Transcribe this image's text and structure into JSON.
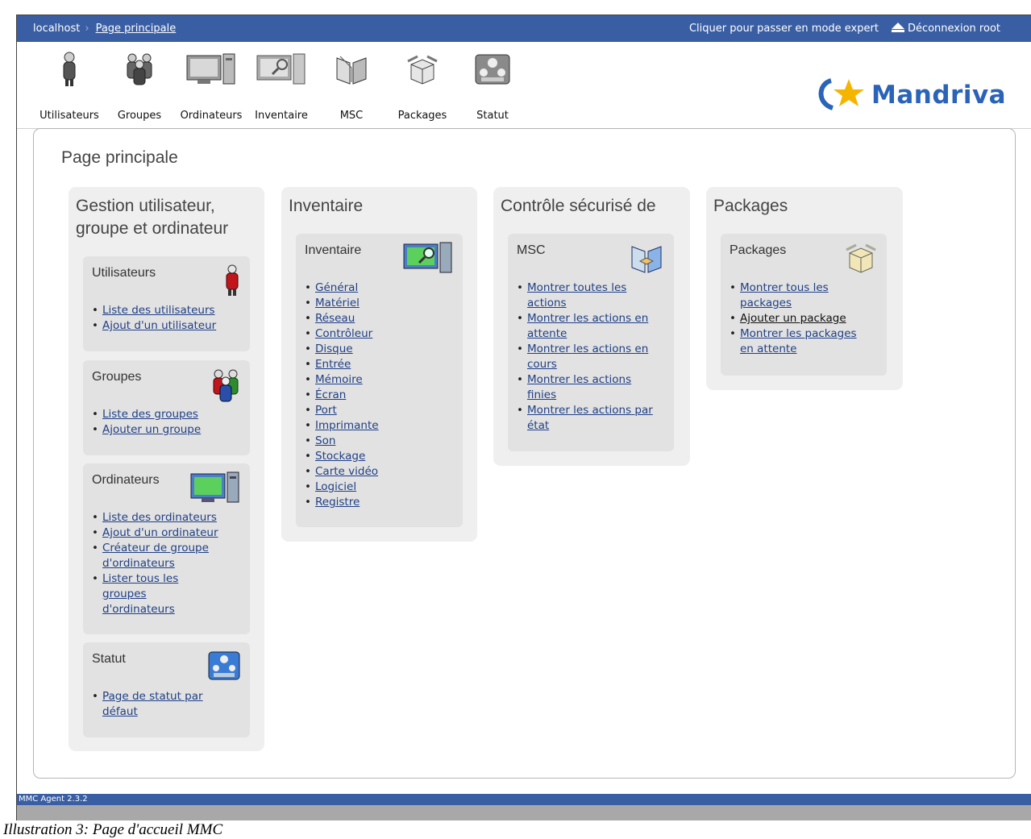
{
  "topbar": {
    "host": "localhost",
    "breadcrumb": "Page principale",
    "expert_link": "Cliquer pour passer en mode expert",
    "logout": "Déconnexion root"
  },
  "toolbar": {
    "items": [
      {
        "label": "Utilisateurs",
        "icon": "user-icon"
      },
      {
        "label": "Groupes",
        "icon": "group-icon"
      },
      {
        "label": "Ordinateurs",
        "icon": "computer-icon"
      },
      {
        "label": "Inventaire",
        "icon": "inventory-icon"
      },
      {
        "label": "MSC",
        "icon": "msc-book-icon"
      },
      {
        "label": "Packages",
        "icon": "package-box-icon"
      },
      {
        "label": "Statut",
        "icon": "status-icon"
      }
    ],
    "logo_text": "Mandriva"
  },
  "main": {
    "title": "Page principale",
    "columns": [
      {
        "title": "Gestion utilisateur, groupe et ordinateur",
        "title_line1": "Gestion utilisateur,",
        "title_line2": "groupe et ordinateur",
        "panels": [
          {
            "title": "Utilisateurs",
            "links": [
              "Liste des utilisateurs",
              "Ajout d'un utilisateur"
            ]
          },
          {
            "title": "Groupes",
            "links": [
              "Liste des groupes",
              "Ajouter un groupe"
            ]
          },
          {
            "title": "Ordinateurs",
            "links": [
              "Liste des ordinateurs",
              "Ajout d'un ordinateur",
              "Créateur de groupe d'ordinateurs",
              "Lister tous les groupes d'ordinateurs"
            ]
          },
          {
            "title": "Statut",
            "links": [
              "Page de statut par défaut"
            ]
          }
        ]
      },
      {
        "title": "Inventaire",
        "panels": [
          {
            "title": "Inventaire",
            "links": [
              "Général",
              "Matériel",
              "Réseau",
              "Contrôleur",
              "Disque",
              "Entrée",
              "Mémoire",
              "Écran",
              "Port",
              "Imprimante",
              "Son",
              "Stockage",
              "Carte vidéo",
              "Logiciel",
              "Registre"
            ]
          }
        ]
      },
      {
        "title": "Contrôle sécurisé de",
        "panels": [
          {
            "title": "MSC",
            "links": [
              "Montrer toutes les actions",
              "Montrer les actions en attente",
              "Montrer les actions en cours",
              "Montrer les actions finies",
              "Montrer les actions par état"
            ]
          }
        ]
      },
      {
        "title": "Packages",
        "panels": [
          {
            "title": "Packages",
            "links": [
              "Montrer tous les packages",
              "Ajouter un package",
              "Montrer les packages en attente"
            ]
          }
        ]
      }
    ]
  },
  "footer": {
    "version": "MMC Agent 2.3.2"
  },
  "caption": "Illustration 3: Page d'accueil MMC",
  "colors": {
    "topbar": "#3a5ea4",
    "link": "#1f3f86",
    "column_bg": "#efefef",
    "panel_bg": "#e2e2e2",
    "logo": "#2a63b8",
    "logo_star": "#f5b400"
  }
}
